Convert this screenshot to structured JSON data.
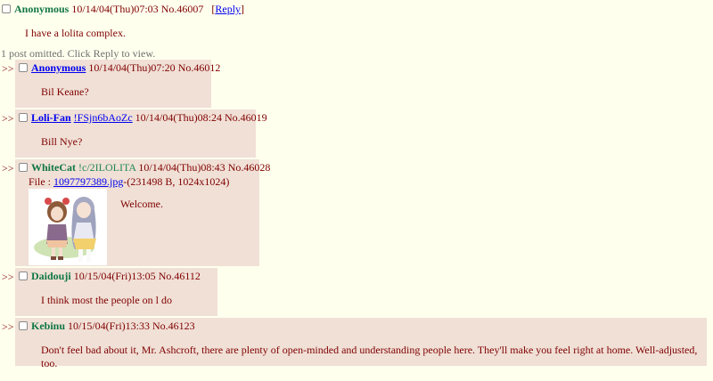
{
  "op": {
    "name": "Anonymous",
    "datetime": "10/14/04(Thu)07:03",
    "post_no": "No.46007",
    "reply_link": "Reply",
    "reply_open": "[",
    "reply_close": "]",
    "body": "I have a lolita complex."
  },
  "omitted": "1 post omitted. Click Reply to view.",
  "arrow": ">>",
  "replies": [
    {
      "name": "Anonymous",
      "datetime": "10/14/04(Thu)07:20",
      "post_no": "No.46012",
      "body": "Bil Keane?"
    },
    {
      "name": "Loli-Fan",
      "tripcode": "!FSjn6bAoZc",
      "datetime": "10/14/04(Thu)08:24",
      "post_no": "No.46019",
      "body": "Bill Nye?"
    },
    {
      "name": "WhiteCat",
      "tripcode": "!c/2ILOLITA",
      "datetime": "10/14/04(Thu)08:43",
      "post_no": "No.46028",
      "file_label": "File :",
      "file_name": "1097797389.jpg",
      "file_info": "-(231498 B, 1024x1024)",
      "body": "Welcome."
    },
    {
      "name": "Daidouji",
      "datetime": "10/15/04(Fri)13:05",
      "post_no": "No.46112",
      "body": "I think most the people on l do"
    },
    {
      "name": "Kebinu",
      "datetime": "10/15/04(Fri)13:33",
      "post_no": "No.46123",
      "body": "Don't feel bad about it, Mr. Ashcroft, there are plenty of open-minded and understanding people here. They'll make you feel right at home. Well-adjusted, too."
    }
  ],
  "colors": {
    "background": "#ffffee",
    "reply_bg": "#f0e0d6",
    "text": "#800000",
    "name": "#117743",
    "link": "#0000ee"
  }
}
